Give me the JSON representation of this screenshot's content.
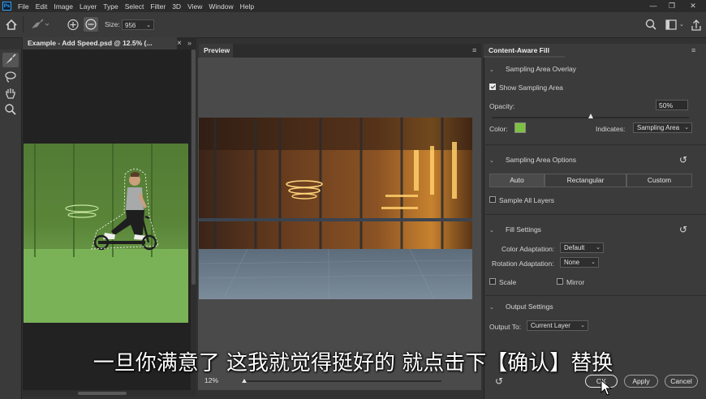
{
  "menubar": {
    "logo": "Ps",
    "items": [
      "File",
      "Edit",
      "Image",
      "Layer",
      "Type",
      "Select",
      "Filter",
      "3D",
      "View",
      "Window",
      "Help"
    ],
    "window_controls": [
      "—",
      "❐",
      "✕"
    ]
  },
  "optionsbar": {
    "size_label": "Size:",
    "size_value": "956"
  },
  "document": {
    "tab_title": "Example - Add Speed.psd @ 12.5% (...",
    "tab_close": "×"
  },
  "preview": {
    "tab_label": "Preview",
    "zoom_value": "12%",
    "zoom_slider_fraction": 0.0
  },
  "content_aware_fill": {
    "panel_title": "Content-Aware Fill",
    "sampling_overlay": {
      "section_label": "Sampling Area Overlay",
      "show_sampling_area_label": "Show Sampling Area",
      "show_sampling_area_checked": true,
      "opacity_label": "Opacity:",
      "opacity_value": "50%",
      "opacity_fraction": 0.5,
      "color_label": "Color:",
      "color_swatch": "#7dc142",
      "indicates_label": "Indicates:",
      "indicates_value": "Sampling Area"
    },
    "sampling_options": {
      "section_label": "Sampling Area Options",
      "buttons": [
        "Auto",
        "Rectangular",
        "Custom"
      ],
      "selected": "Auto",
      "sample_all_layers_label": "Sample All Layers",
      "sample_all_layers_checked": false
    },
    "fill_settings": {
      "section_label": "Fill Settings",
      "color_adaptation_label": "Color Adaptation:",
      "color_adaptation_value": "Default",
      "rotation_adaptation_label": "Rotation Adaptation:",
      "rotation_adaptation_value": "None",
      "scale_label": "Scale",
      "scale_checked": false,
      "mirror_label": "Mirror",
      "mirror_checked": false
    },
    "output_settings": {
      "section_label": "Output Settings",
      "output_to_label": "Output To:",
      "output_to_value": "Current Layer"
    },
    "footer": {
      "ok_label": "OK",
      "apply_label": "Apply",
      "cancel_label": "Cancel"
    }
  },
  "subtitle": "一旦你满意了 这我就觉得挺好的 就点击下【确认】替换",
  "colors": {
    "ps_blue": "#31a8ff",
    "overlay_green": "#7dc142"
  }
}
